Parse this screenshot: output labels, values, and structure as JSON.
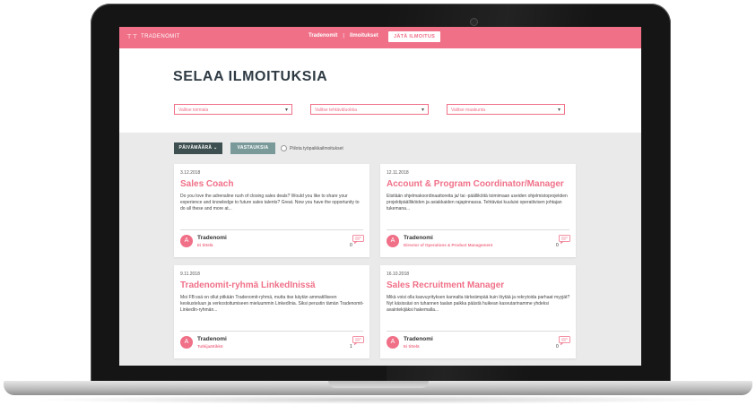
{
  "nav": {
    "brand": "TRADENOMIT",
    "link_tradenomit": "Tradenomit",
    "link_ilmoitukset": "Ilmoitukset",
    "cta": "JÄTÄ ILMOITUS"
  },
  "page": {
    "title": "SELAA ILMOITUKSIA"
  },
  "filters": {
    "industry": "Valitse toimiala",
    "category": "Valitse tehtäväluokka",
    "region": "Valitse maakunta"
  },
  "sort": {
    "date_label": "PÄIVÄMÄÄRÄ",
    "replies_label": "VASTAUKSIA",
    "jobs_only_label": "Piilota työpaikkailmoitukset"
  },
  "cards": [
    {
      "date": "3.12.2018",
      "title": "Sales Coach",
      "text": "Do you love the adrenaline rush of closing sales deals? Would you like to share your experience and knowledge to future sales talents? Great. Now you have the opportunity to do all these and more at...",
      "author": "Tradenomi",
      "author_sub": "Ei tittelä",
      "count": "0"
    },
    {
      "date": "12.11.2018",
      "title": "Account & Program Coordinator/Manager",
      "text": "Etsitään ohjelmakoordinaattoreita ja/ tai -päälliköitä toimimaan useiden ohjelmistoprojektien projektipäälliköiden ja asiakkaiden rajapinnassa. Tehtäväsi kuuluisi operatiivisen johtajan tukemana...",
      "author": "Tradenomi",
      "author_sub": "Director of Operations & Product Management",
      "count": "0"
    },
    {
      "date": "9.11.2018",
      "title": "Tradenomit-ryhmä LinkedInissä",
      "text": "Moi FB:ssä on ollut pitkään Tradenomit-ryhmä, mutta itse käytän ammatilliseen keskusteluun ja verkostoitumiseen mieluummin LinkedInia. Siksi perustin tämän Tradenomit-LinkedIn-ryhmän...",
      "author": "Tradenomi",
      "author_sub": "Tutkijaättikkö",
      "count": "1"
    },
    {
      "date": "16.10.2018",
      "title": "Sales Recruitment Manager",
      "text": "Mikä voisi olla kasvuyrityksen kannalta tärkeämpää kuin löytää ja rekrytoida parhaat myyjät? Nyt käsissäsi on tuhannen taalan paikka päästä huikean kasvutarinamme yhdeksi avaintekijäksi hakemalla...",
      "author": "Tradenomi",
      "author_sub": "Ei tittelä",
      "count": "0"
    }
  ],
  "colors": {
    "brand_pink": "#f07088",
    "dark_teal": "#3d4f50",
    "muted_teal": "#7a9a9a"
  }
}
